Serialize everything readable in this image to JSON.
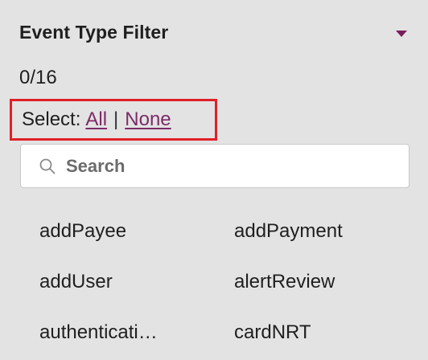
{
  "filter": {
    "title": "Event Type Filter",
    "count": "0/16",
    "select_label": "Select:",
    "select_all": "All",
    "separator": "|",
    "select_none": "None",
    "search_placeholder": "Search"
  },
  "options": [
    "addPayee",
    "addPayment",
    "addUser",
    "alertReview",
    "authenticati…",
    "cardNRT"
  ],
  "colors": {
    "accent": "#7c2b67",
    "highlight_box": "#e02026",
    "background": "#e3e3e3"
  },
  "icons": {
    "collapse": "caret-down-icon",
    "search": "search-icon"
  }
}
